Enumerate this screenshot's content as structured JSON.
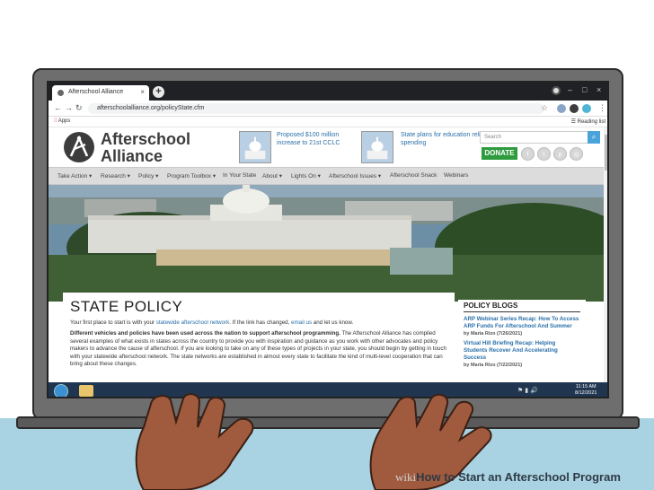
{
  "browser": {
    "tab_title": "Afterschool Alliance",
    "url": "afterschoolalliance.org/policyState.cfm",
    "bookmarks": {
      "apps": "Apps",
      "reading_list": "Reading list"
    }
  },
  "site": {
    "logo_line1": "Afterschool",
    "logo_line2": "Alliance",
    "news": [
      {
        "text": "Proposed $100 million increase to 21st CCLC"
      },
      {
        "text": "State plans for education relief spending"
      }
    ],
    "search_placeholder": "Search",
    "donate_label": "DONATE",
    "nav": [
      "Take Action ▾",
      "Research ▾",
      "Policy ▾",
      "Program Toolbox ▾",
      "In Your State",
      "About ▾",
      "Lights On ▾",
      "Afterschool Issues ▾",
      "Afterschool Snack",
      "Webinars"
    ]
  },
  "content": {
    "title": "STATE POLICY",
    "intro_pre": "Your first place to start is with your ",
    "intro_link1": "statewide afterschool network",
    "intro_mid": ". If the link has changed, ",
    "intro_link2": "email us",
    "intro_post": " and let us know.",
    "para_bold": "Different vehicles and policies have been used across the nation to support afterschool programming.",
    "para_rest": " The Afterschool Alliance has compiled several examples of what exists in states across the country to provide you with inspiration and guidance as you work with other advocates and policy makers to advance the cause of afterschool. If you are looking to take on any of these types of projects in your state, you should begin by getting in touch with your statewide afterschool network. The state networks are established in almost every state to facilitate the kind of multi-level cooperation that can bring about these changes."
  },
  "blogs": {
    "heading": "POLICY BLOGS",
    "items": [
      {
        "title": "ARP Webinar Series Recap: How To Access ARP Funds For Afterschool And Summer",
        "meta": "by Maria Rizo (7/26/2021)"
      },
      {
        "title": "Virtual Hill Briefing Recap: Helping Students Recover And Accelerating Success",
        "meta": "by Maria Rizo (7/22/2021)"
      }
    ]
  },
  "taskbar": {
    "time": "11:15 AM",
    "date": "8/12/2021"
  },
  "branding": {
    "wiki": "wiki",
    "how": "How",
    "title": " to Start an Afterschool Program"
  },
  "colors": {
    "accent": "#2a6fa8",
    "donate": "#2e9b3f",
    "taskbar": "#1f3550",
    "desk": "#a9d3e2"
  }
}
